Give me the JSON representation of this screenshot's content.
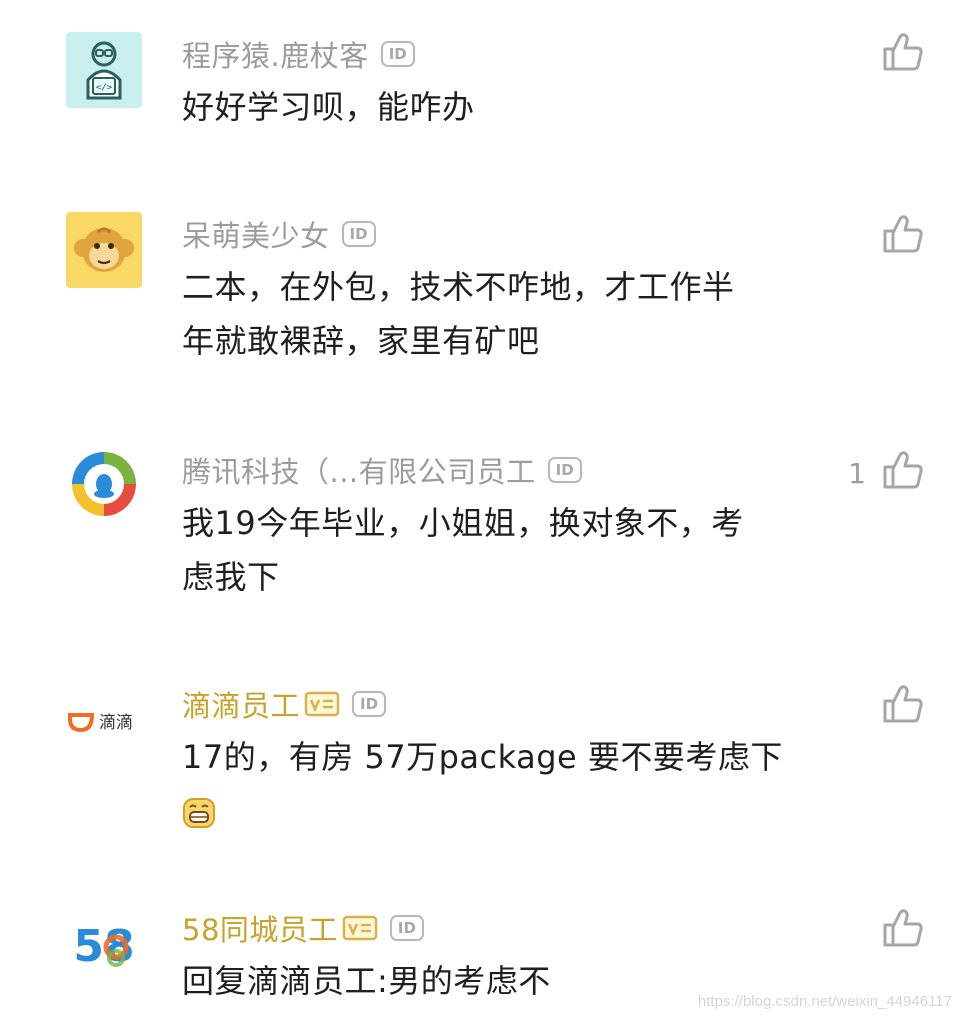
{
  "comments": [
    {
      "username": "程序猿.鹿杖客",
      "id_tag": "ID",
      "text": "好好学习呗，能咋办",
      "likes": "",
      "avatar": "programmer-avatar-icon"
    },
    {
      "username": "呆萌美少女",
      "id_tag": "ID",
      "text_line1": "二本，在外包，技术不咋地，才工作半",
      "text_line2": "年就敢裸辞，家里有矿吧",
      "likes": "",
      "avatar": "monkey-avatar-icon"
    },
    {
      "username": "腾讯科技（...有限公司员工",
      "id_tag": "ID",
      "text_line1": "我19今年毕业，小姐姐，换对象不，考",
      "text_line2": "虑我下",
      "likes": "1",
      "avatar": "tencent-logo-icon"
    },
    {
      "username": "滴滴员工",
      "id_tag": "ID",
      "text": "17的，有房 57万package 要不要考虑下",
      "likes": "",
      "avatar_label": "滴滴",
      "avatar": "didi-logo-icon",
      "verified": true
    },
    {
      "username": "58同城员工",
      "id_tag": "ID",
      "text": "回复滴滴员工:男的考虑不",
      "likes": "",
      "avatar_label": "58",
      "avatar": "58-logo-icon",
      "verified": true
    }
  ],
  "colors": {
    "name_gray": "#9c9c9c",
    "name_gold": "#c9a227",
    "text": "#1f1f1f",
    "icon_gray": "#a6a6a6"
  },
  "watermark": "https://blog.csdn.net/weixin_44946117"
}
